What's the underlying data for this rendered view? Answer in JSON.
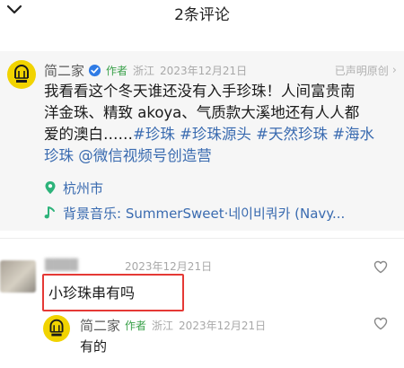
{
  "header": {
    "title": "2条评论"
  },
  "post": {
    "author": "简二家",
    "author_tag": "作者",
    "region": "浙江",
    "date": "2023年12月21日",
    "declaration": "已声明原创",
    "text_lines": [
      "我看看这个冬天谁还没有入手珍珠！人间富贵南",
      "洋金珠、精致 akoya、气质款大溪地还有人人都",
      "爱的澳白……"
    ],
    "hashtags_line3": [
      "#珍珠",
      "#珍珠源头",
      "#天然珍珠",
      "#海水"
    ],
    "line4_tag": "珍珠",
    "line4_rest": "@微信视频号创造营",
    "location": "杭州市",
    "music": "背景音乐: SummerSweet·네이비쿼카 (Navy..."
  },
  "comment": {
    "date": "2023年12月21日",
    "text": "小珍珠串有吗"
  },
  "reply": {
    "author": "简二家",
    "author_tag": "作者",
    "region": "浙江",
    "date": "2023年12月21日",
    "text": "有的"
  },
  "colors": {
    "accent_green": "#3aa14a",
    "link_blue": "#3a6bb0",
    "avatar_yellow": "#f1d300",
    "highlight_red": "#e53935"
  },
  "icons": [
    "chevron-down-icon",
    "verified-icon",
    "chevron-right-icon",
    "location-pin-icon",
    "music-note-icon",
    "heart-icon"
  ]
}
